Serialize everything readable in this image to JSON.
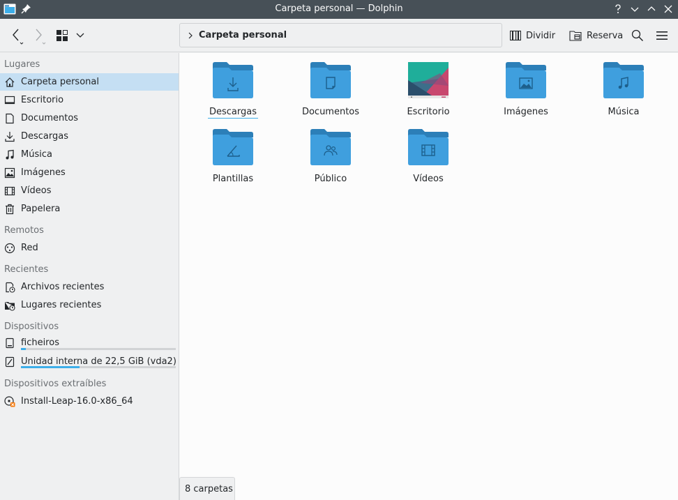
{
  "window": {
    "title": "Carpeta personal — Dolphin"
  },
  "toolbar": {
    "breadcrumb": "Carpeta personal",
    "split_label": "Dividir",
    "stash_label": "Reserva"
  },
  "sidebar": {
    "sections": {
      "places": "Lugares",
      "remote": "Remotos",
      "recent": "Recientes",
      "devices": "Dispositivos",
      "removable": "Dispositivos extraíbles"
    },
    "places": [
      {
        "label": "Carpeta personal",
        "icon": "home-icon"
      },
      {
        "label": "Escritorio",
        "icon": "desktop-icon"
      },
      {
        "label": "Documentos",
        "icon": "documents-icon"
      },
      {
        "label": "Descargas",
        "icon": "download-icon"
      },
      {
        "label": "Música",
        "icon": "music-icon"
      },
      {
        "label": "Imágenes",
        "icon": "pictures-icon"
      },
      {
        "label": "Vídeos",
        "icon": "videos-icon"
      },
      {
        "label": "Papelera",
        "icon": "trash-icon"
      }
    ],
    "remote": [
      {
        "label": "Red",
        "icon": "network-icon"
      }
    ],
    "recent": [
      {
        "label": "Archivos recientes",
        "icon": "recent-files-icon"
      },
      {
        "label": "Lugares recientes",
        "icon": "recent-places-icon"
      }
    ],
    "devices": [
      {
        "label": "ficheiros",
        "icon": "drive-icon",
        "usage": 0.03
      },
      {
        "label": "Unidad interna de 22,5 GiB (vda2)",
        "icon": "harddisk-icon",
        "usage": 0.38
      }
    ],
    "removable": [
      {
        "label": "Install-Leap-16.0-x86_64",
        "icon": "optical-disc-icon"
      }
    ]
  },
  "folders": [
    {
      "name": "Descargas",
      "icon": "download-icon"
    },
    {
      "name": "Documentos",
      "icon": "document-icon"
    },
    {
      "name": "Escritorio",
      "icon": "desktop-wallpaper-thumbnail"
    },
    {
      "name": "Imágenes",
      "icon": "image-icon"
    },
    {
      "name": "Música",
      "icon": "music-note-icon"
    },
    {
      "name": "Plantillas",
      "icon": "template-icon"
    },
    {
      "name": "Público",
      "icon": "people-icon"
    },
    {
      "name": "Vídeos",
      "icon": "film-icon"
    }
  ],
  "status": {
    "text": "8 carpetas"
  },
  "colors": {
    "accent": "#3daee9",
    "folder": "#3f9fde",
    "folder_tab": "#2c7fb8",
    "titlebar": "#475057",
    "selection": "#c5dff3"
  }
}
